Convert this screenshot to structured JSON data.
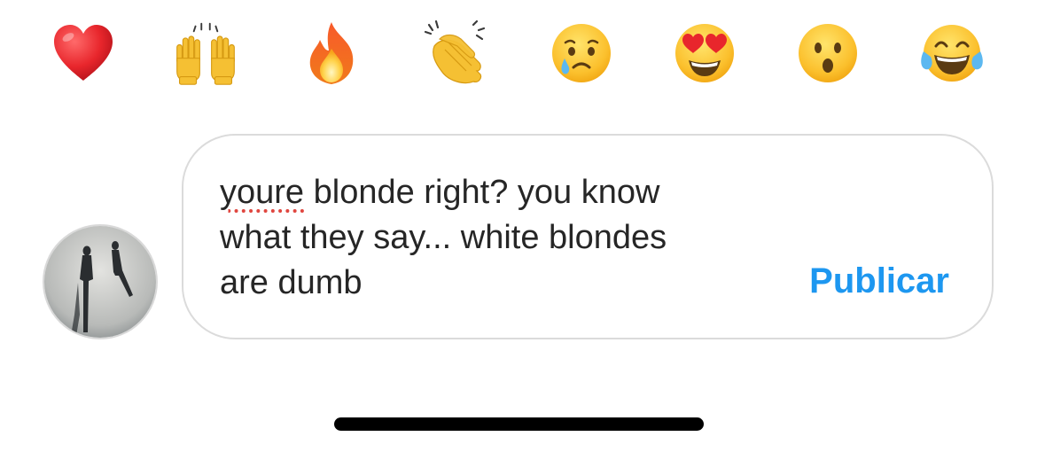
{
  "reactions": [
    {
      "name": "heart",
      "icon": "red-heart-icon"
    },
    {
      "name": "raising-hands",
      "icon": "raising-hands-icon"
    },
    {
      "name": "fire",
      "icon": "fire-icon"
    },
    {
      "name": "clapping-hands",
      "icon": "clapping-hands-icon"
    },
    {
      "name": "crying-face",
      "icon": "crying-face-icon"
    },
    {
      "name": "heart-eyes",
      "icon": "heart-eyes-icon"
    },
    {
      "name": "surprised-face",
      "icon": "surprised-face-icon"
    },
    {
      "name": "tears-of-joy",
      "icon": "tears-of-joy-icon"
    }
  ],
  "comment": {
    "misspelled_word": "youre",
    "text_rest": " blonde right? you know\nwhat they say... white blondes\nare dumb",
    "publish_label": "Publicar"
  },
  "colors": {
    "accent": "#1d97f0",
    "text": "#262626",
    "border": "#dbdbdb",
    "spellcheck": "#e0463f"
  }
}
